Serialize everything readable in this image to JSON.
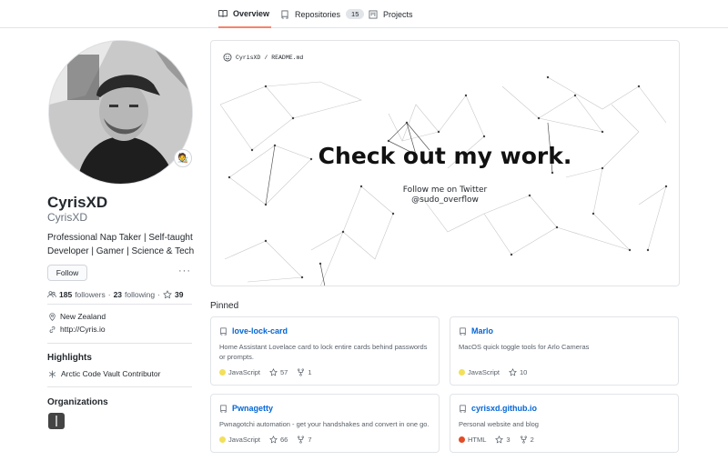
{
  "tabs": [
    {
      "label": "Overview",
      "icon": "book-icon",
      "active": true
    },
    {
      "label": "Repositories",
      "icon": "repo-icon",
      "count": "15"
    },
    {
      "label": "Projects",
      "icon": "project-icon"
    }
  ],
  "profile": {
    "name": "CyrisXD",
    "login": "CyrisXD",
    "bio": "Professional Nap Taker | Self-taught Developer | Gamer | Science & Tech",
    "status_emoji": "🧑‍🎨",
    "follow_label": "Follow",
    "more_label": "···",
    "followers_count": "185",
    "followers_label": "followers",
    "following_count": "23",
    "following_label": "following",
    "separator": "·",
    "stars_count": "39",
    "location": "New Zealand",
    "website": "http://Cyris.io"
  },
  "highlights": {
    "title": "Highlights",
    "items": [
      "Arctic Code Vault Contributor"
    ]
  },
  "organizations": {
    "title": "Organizations"
  },
  "readme": {
    "path_user": "CyrisXD",
    "path_sep": "/",
    "path_file": "README.md",
    "heading": "Check out my work.",
    "line1": "Follow me on Twitter",
    "line2": "@sudo_overflow"
  },
  "pinned": {
    "label": "Pinned",
    "cards": [
      {
        "name": "love-lock-card",
        "description": "Home Assistant Lovelace card to lock entire cards behind passwords or prompts.",
        "language": "JavaScript",
        "lang_color": "#f1e05a",
        "stars": "57",
        "forks": "1"
      },
      {
        "name": "Marlo",
        "description": "MacOS quick toggle tools for Arlo Cameras",
        "language": "JavaScript",
        "lang_color": "#f1e05a",
        "stars": "10",
        "forks": ""
      },
      {
        "name": "Pwnagetty",
        "description": "Pwnagotchi automation - get your handshakes and convert in one go.",
        "language": "JavaScript",
        "lang_color": "#f1e05a",
        "stars": "66",
        "forks": "7"
      },
      {
        "name": "cyrisxd.github.io",
        "description": "Personal website and blog",
        "language": "HTML",
        "lang_color": "#e34c26",
        "stars": "3",
        "forks": "2"
      }
    ]
  },
  "colors": {
    "link": "#0366d6",
    "tab_underline": "#f9826c",
    "border": "#e1e4e8",
    "muted": "#586069"
  }
}
